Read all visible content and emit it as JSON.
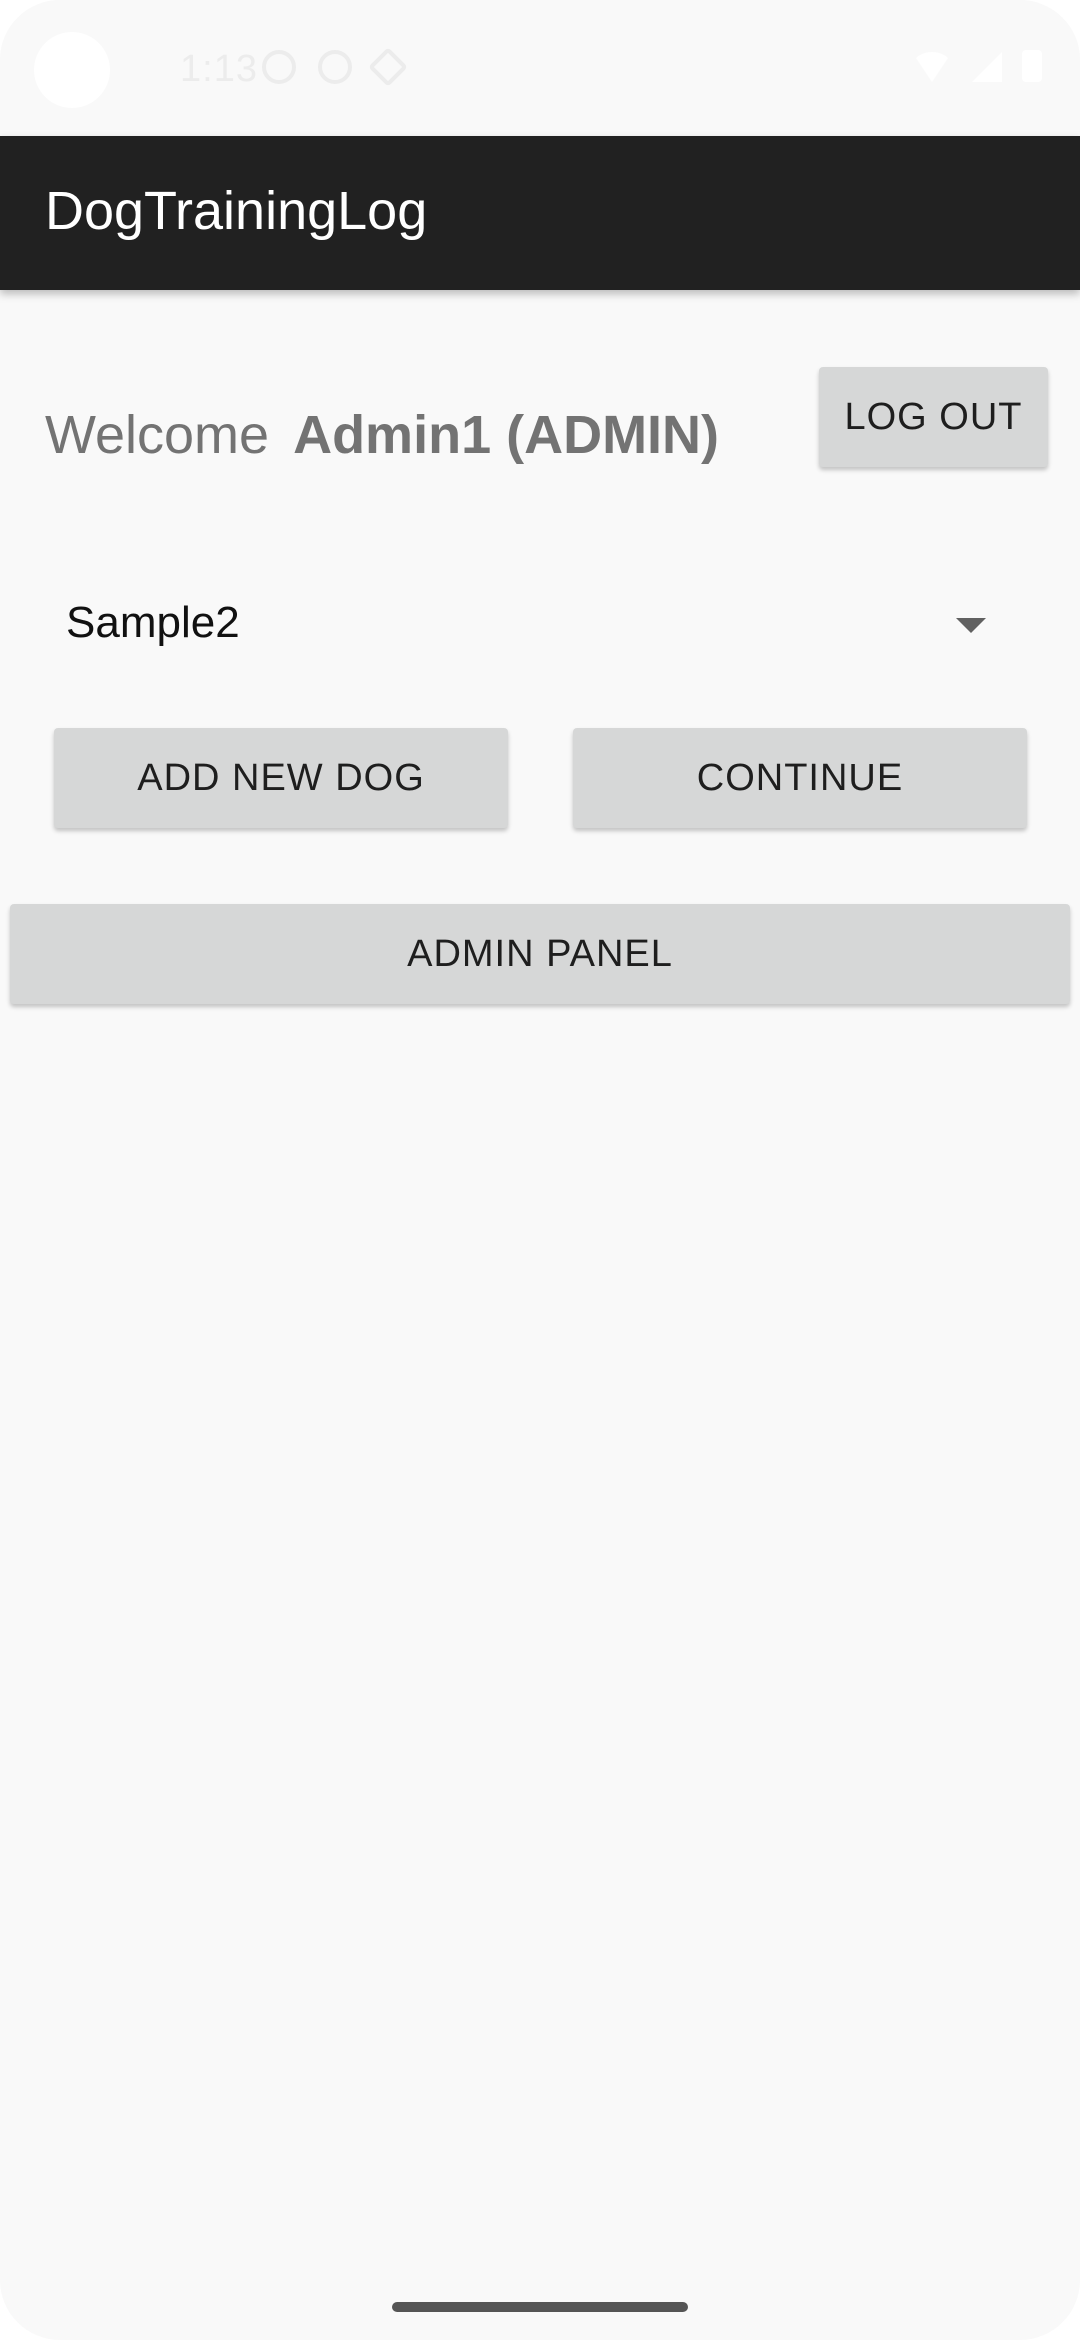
{
  "status_bar": {
    "time": "1:13",
    "icons": [
      "settings-icon",
      "location-off-icon",
      "navigation-icon",
      "wifi-icon",
      "signal-icon",
      "battery-icon"
    ]
  },
  "app_bar": {
    "title": "DogTrainingLog",
    "background": "#212121"
  },
  "welcome": {
    "label": "Welcome",
    "user": "Admin1 (ADMIN)"
  },
  "buttons": {
    "logout": "LOG OUT",
    "add_new_dog": "ADD NEW DOG",
    "continue": "CONTINUE",
    "admin_panel": "ADMIN PANEL"
  },
  "dog_spinner": {
    "selected": "Sample2"
  },
  "colors": {
    "button_bg": "#d6d7d7",
    "screen_bg": "#f9f9f9"
  }
}
